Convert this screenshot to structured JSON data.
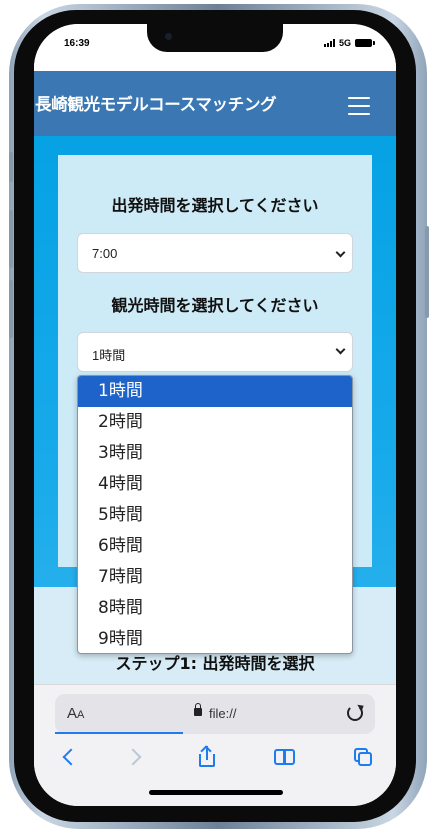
{
  "status_bar": {
    "time": "16:39",
    "network": "5G"
  },
  "header": {
    "title": "長崎観光モデルコースマッチング",
    "menu_icon": "hamburger-menu-icon"
  },
  "form": {
    "departure_heading": "出発時間を選択してください",
    "departure_value": "7:00",
    "duration_heading": "観光時間を選択してください",
    "duration_value": "1時間"
  },
  "dropdown": {
    "options": [
      "1時間",
      "2時間",
      "3時間",
      "4時間",
      "5時間",
      "6時間",
      "7時間",
      "8時間",
      "9時間"
    ],
    "selected": "1時間"
  },
  "step_text": "ステップ1: 出発時間を選択",
  "browser": {
    "aa_label": "A",
    "aa_small": "A",
    "url": "file://",
    "icons": [
      "back-icon",
      "forward-icon",
      "share-icon",
      "bookmarks-icon",
      "tabs-icon",
      "reload-icon",
      "lock-icon"
    ]
  },
  "colors": {
    "header_bg": "#3b78b3",
    "page_bg": "#05a2e4",
    "card_bg": "#cdeaf7",
    "selected_option": "#1d63c9",
    "safari_accent": "#1e7cf0"
  }
}
